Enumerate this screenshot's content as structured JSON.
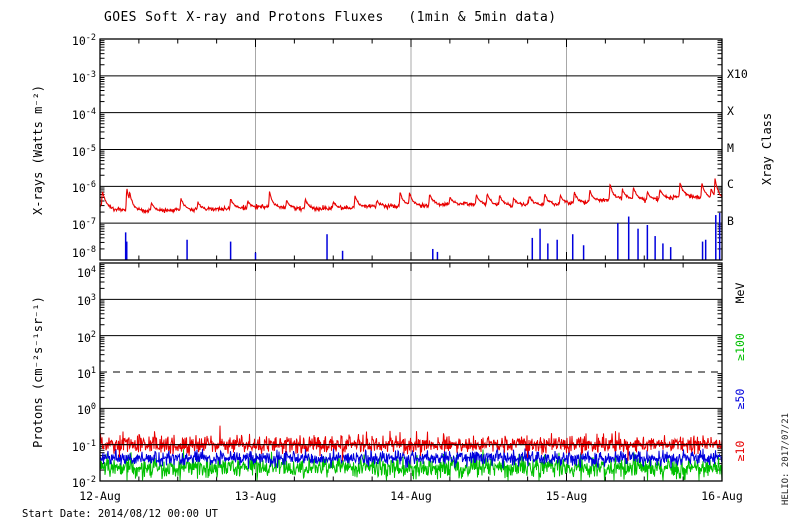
{
  "chart_data": {
    "type": "line",
    "title": "GOES Soft X-ray and Protons Fluxes   (1min & 5min data)",
    "start_date_label": "Start Date: 2014/08/12 00:00 UT",
    "credit": "HELIO: 2017/07/21",
    "colors": {
      "red": "#e80000",
      "blue": "#0000dd",
      "green": "#00c000",
      "grid_gray": "#a8a8a8",
      "axis": "#000000"
    },
    "x_axis": {
      "tick_labels": [
        "12-Aug",
        "13-Aug",
        "14-Aug",
        "15-Aug",
        "16-Aug"
      ],
      "range_days": [
        0,
        4
      ],
      "minor_tick_hours": 6
    },
    "xray_panel": {
      "ylabel": "X-rays (Watts m⁻²)",
      "yrange_log": [
        -8,
        -2
      ],
      "ytick_exponents": [
        -2,
        -3,
        -4,
        -5,
        -6,
        -7,
        -8
      ],
      "right_title": "Xray Class",
      "class_labels": [
        {
          "text": "X10",
          "log": -3
        },
        {
          "text": "X",
          "log": -4
        },
        {
          "text": "M",
          "log": -5
        },
        {
          "text": "C",
          "log": -6
        },
        {
          "text": "B",
          "log": -7
        }
      ],
      "series": [
        {
          "name": "xray-flux-long-1min",
          "color": "#e80000",
          "noise_sigma": 0.03,
          "spike_rise": 0.006,
          "spike_decay": 0.022,
          "baseline_keypoints": [
            [
              0,
              -6.52
            ],
            [
              0.08,
              -6.62
            ],
            [
              0.3,
              -6.67
            ],
            [
              0.55,
              -6.63
            ],
            [
              0.8,
              -6.61
            ],
            [
              1.05,
              -6.56
            ],
            [
              1.35,
              -6.62
            ],
            [
              1.7,
              -6.56
            ],
            [
              2.05,
              -6.52
            ],
            [
              2.35,
              -6.47
            ],
            [
              2.65,
              -6.52
            ],
            [
              2.95,
              -6.47
            ],
            [
              3.15,
              -6.42
            ],
            [
              3.35,
              -6.33
            ],
            [
              3.55,
              -6.37
            ],
            [
              3.75,
              -6.27
            ],
            [
              3.9,
              -6.32
            ],
            [
              4,
              -6.35
            ]
          ],
          "spikes": [
            [
              0.015,
              0.42
            ],
            [
              0.172,
              0.6
            ],
            [
              0.19,
              0.5
            ],
            [
              0.33,
              0.22
            ],
            [
              0.52,
              0.32
            ],
            [
              0.63,
              0.2
            ],
            [
              0.84,
              0.28
            ],
            [
              0.95,
              0.18
            ],
            [
              1.09,
              0.42
            ],
            [
              1.2,
              0.22
            ],
            [
              1.32,
              0.28
            ],
            [
              1.5,
              0.18
            ],
            [
              1.64,
              0.32
            ],
            [
              1.78,
              0.18
            ],
            [
              1.93,
              0.4
            ],
            [
              1.99,
              0.36
            ],
            [
              2.12,
              0.32
            ],
            [
              2.25,
              0.18
            ],
            [
              2.42,
              0.26
            ],
            [
              2.49,
              0.32
            ],
            [
              2.57,
              0.28
            ],
            [
              2.66,
              0.22
            ],
            [
              2.76,
              0.26
            ],
            [
              2.86,
              0.28
            ],
            [
              2.96,
              0.22
            ],
            [
              3.05,
              0.28
            ],
            [
              3.15,
              0.32
            ],
            [
              3.28,
              0.42
            ],
            [
              3.36,
              0.26
            ],
            [
              3.43,
              0.32
            ],
            [
              3.52,
              0.22
            ],
            [
              3.6,
              0.26
            ],
            [
              3.73,
              0.38
            ],
            [
              3.87,
              0.42
            ],
            [
              3.93,
              0.28
            ],
            [
              3.955,
              0.55
            ]
          ]
        },
        {
          "name": "xray-flux-short-events",
          "color": "#0000dd",
          "floor_log": -8,
          "events": [
            [
              0.165,
              -7.25
            ],
            [
              0.172,
              -7.5
            ],
            [
              0.56,
              -7.45
            ],
            [
              0.84,
              -7.5
            ],
            [
              1.0,
              -7.8
            ],
            [
              1.46,
              -7.3
            ],
            [
              1.56,
              -7.75
            ],
            [
              2.14,
              -7.7
            ],
            [
              2.17,
              -7.78
            ],
            [
              2.78,
              -7.4
            ],
            [
              2.83,
              -7.15
            ],
            [
              2.88,
              -7.55
            ],
            [
              2.94,
              -7.45
            ],
            [
              3.04,
              -7.3
            ],
            [
              3.11,
              -7.6
            ],
            [
              3.33,
              -7.0
            ],
            [
              3.4,
              -6.82
            ],
            [
              3.46,
              -7.15
            ],
            [
              3.52,
              -7.05
            ],
            [
              3.57,
              -7.35
            ],
            [
              3.62,
              -7.55
            ],
            [
              3.67,
              -7.65
            ],
            [
              3.875,
              -7.5
            ],
            [
              3.895,
              -7.45
            ],
            [
              3.96,
              -6.78
            ],
            [
              3.985,
              -6.72
            ]
          ]
        }
      ]
    },
    "proton_panel": {
      "ylabel": "Protons (cm⁻²s⁻¹sr⁻¹)",
      "yrange_log": [
        -2,
        4
      ],
      "ytick_exponents": [
        4,
        3,
        2,
        1,
        0,
        -1,
        -2
      ],
      "dashed_gridline_log": 1,
      "right_title": "MeV",
      "energy_labels": [
        {
          "text": "≥100",
          "color": "#00c000"
        },
        {
          "text": "≥50",
          "color": "#0000dd"
        },
        {
          "text": "≥10",
          "color": "#e80000"
        }
      ],
      "series": [
        {
          "name": "protons ≥10 MeV",
          "color": "#e80000",
          "baseline_log": -1.0,
          "noise_sigma": 0.12,
          "spike_prob": 0.02,
          "spike_amp": 0.4
        },
        {
          "name": "protons ≥50 MeV",
          "color": "#0000dd",
          "baseline_log": -1.37,
          "noise_sigma": 0.1
        },
        {
          "name": "protons ≥100 MeV",
          "color": "#00c000",
          "baseline_log": -1.63,
          "noise_sigma": 0.15
        }
      ]
    }
  }
}
